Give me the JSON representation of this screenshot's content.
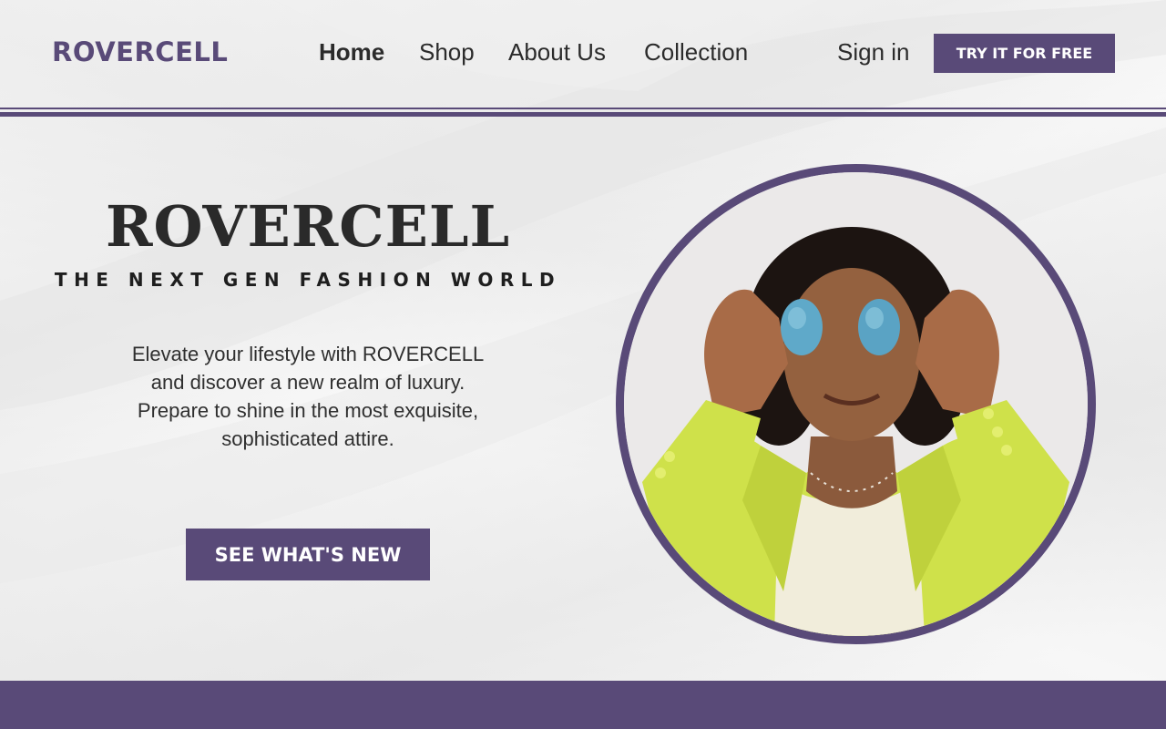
{
  "header": {
    "logo": "ROVERCELL",
    "nav": {
      "home": "Home",
      "shop": "Shop",
      "about": "About Us",
      "collection": "Collection"
    },
    "sign_in": "Sign in",
    "cta": "TRY IT FOR FREE"
  },
  "hero": {
    "title": "ROVERCELL",
    "subtitle": "THE NEXT GEN FASHION WORLD",
    "description_lines": [
      "Elevate your lifestyle with ROVERCELL",
      "and discover a new realm of luxury.",
      "Prepare to shine in the most exquisite,",
      "sophisticated attire."
    ],
    "cta": "SEE WHAT'S NEW"
  },
  "image": {
    "icon": "portrait-photo"
  },
  "colors": {
    "brand": "#594a78",
    "text": "#2a2a2a",
    "background": "#f2f2f2"
  }
}
